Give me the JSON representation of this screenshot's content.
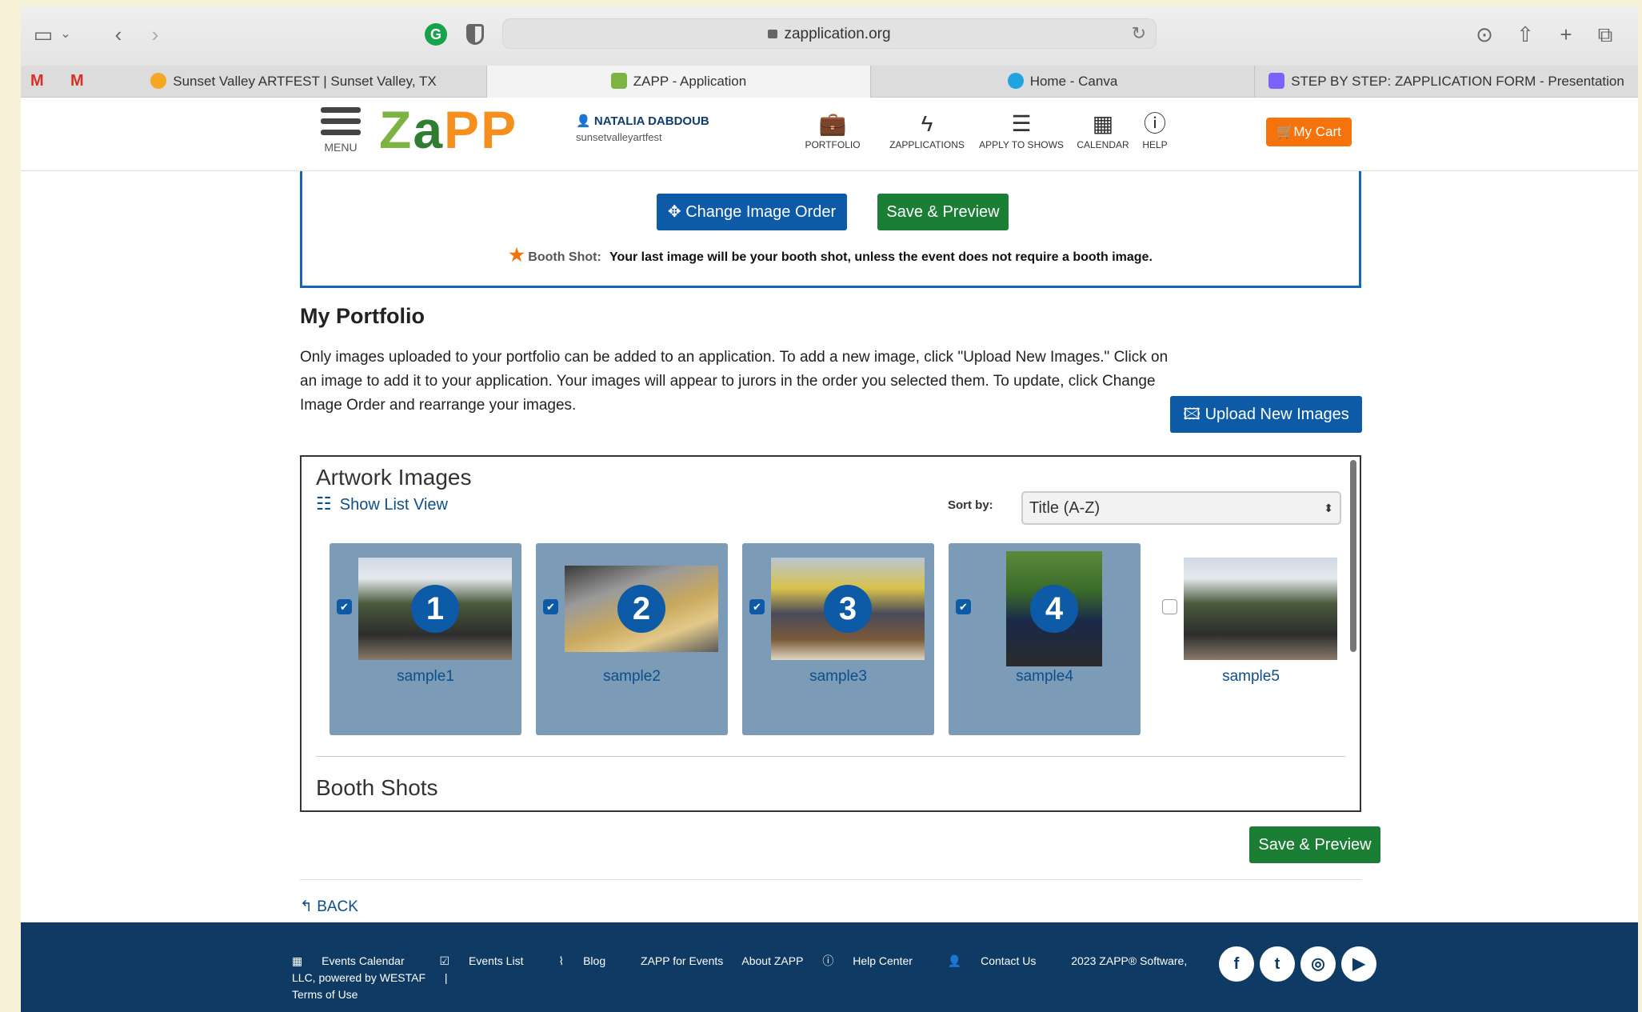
{
  "browser": {
    "url": "zapplication.org",
    "tabs": [
      {
        "label": "Sunset Valley ARTFEST | Sunset Valley, TX"
      },
      {
        "label": "ZAPP - Application"
      },
      {
        "label": "Home - Canva"
      },
      {
        "label": "STEP BY STEP: ZAPPLICATION FORM - Presentation"
      }
    ],
    "mail_glyph": "M"
  },
  "header": {
    "menu_label": "MENU",
    "logo": {
      "z": "Z",
      "a": "a",
      "pp": "PP"
    },
    "user_name": "NATALIA DABDOUB",
    "user_handle": "sunsetvalleyartfest",
    "nav": [
      {
        "label": "PORTFOLIO",
        "icon": "briefcase-icon"
      },
      {
        "label": "ZAPPLICATIONS",
        "icon": "lightning-icon"
      },
      {
        "label": "APPLY TO SHOWS",
        "icon": "checklist-icon"
      },
      {
        "label": "CALENDAR",
        "icon": "calendar-icon"
      },
      {
        "label": "HELP",
        "icon": "info-icon"
      }
    ],
    "cart_label": "My Cart"
  },
  "top_box": {
    "change_order_label": "Change Image Order",
    "save_preview_label": "Save & Preview",
    "booth_label": "Booth Shot:",
    "booth_text": "Your last image will be your booth shot, unless the event does not require a booth image."
  },
  "portfolio": {
    "title": "My Portfolio",
    "description": "Only images uploaded to your portfolio can be added to an application. To add a new image, click \"Upload New Images.\" Click on an image to add it to your application. Your images will appear to jurors in the order you selected them. To update, click Change Image Order and rearrange your images.",
    "upload_label": "Upload New Images"
  },
  "artwork": {
    "title": "Artwork Images",
    "list_view_label": "Show List View",
    "sort_label": "Sort by:",
    "sort_value": "Title (A-Z)",
    "images": [
      {
        "name": "sample1",
        "order": "1",
        "selected": true
      },
      {
        "name": "sample2",
        "order": "2",
        "selected": true
      },
      {
        "name": "sample3",
        "order": "3",
        "selected": true
      },
      {
        "name": "sample4",
        "order": "4",
        "selected": true
      },
      {
        "name": "sample5",
        "order": "",
        "selected": false
      }
    ],
    "booth_title": "Booth Shots"
  },
  "bottom": {
    "save_preview_label": "Save & Preview",
    "back_label": "BACK"
  },
  "footer": {
    "links": [
      "Events Calendar",
      "Events List",
      "Blog",
      "ZAPP for Events",
      "About ZAPP",
      "Help Center",
      "Contact Us"
    ],
    "copyright": "2023 ZAPP® Software, LLC, powered by WESTAF",
    "separator": "|",
    "terms": "Terms of Use",
    "social": [
      "facebook-icon",
      "twitter-icon",
      "instagram-icon",
      "youtube-icon"
    ]
  },
  "colors": {
    "brand_blue": "#0d5aa7",
    "brand_green": "#1b7e35",
    "cart_orange": "#f5730a",
    "footer_navy": "#0e3a63"
  }
}
